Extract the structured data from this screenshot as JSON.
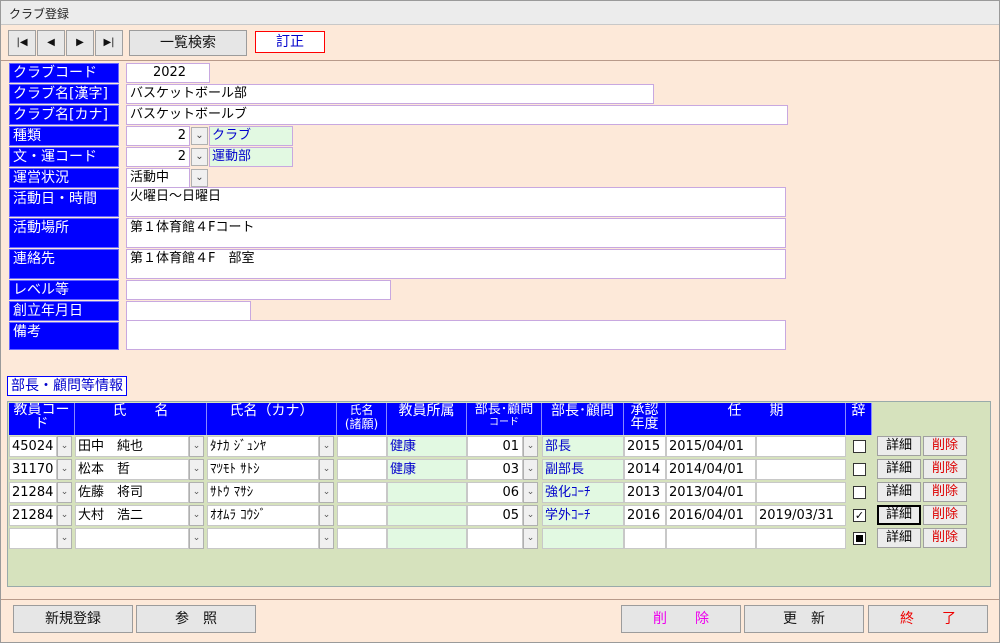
{
  "window": {
    "title": "クラブ登録"
  },
  "toolbar": {
    "first": "|◀",
    "prev": "◀",
    "next": "▶",
    "last": "▶|",
    "search_label": "一覧検索",
    "correct_label": "訂正"
  },
  "form": {
    "club_code": {
      "label": "クラブコード",
      "value": "2022"
    },
    "club_name_kanji": {
      "label": "クラブ名[漢字]",
      "value": "バスケットボール部"
    },
    "club_name_kana": {
      "label": "クラブ名[カナ]",
      "value": "バスケットボールブ"
    },
    "kind": {
      "label": "種類",
      "code": "2",
      "name": "クラブ"
    },
    "bun_un_code": {
      "label": "文・運コード",
      "code": "2",
      "name": "運動部"
    },
    "status": {
      "label": "運営状況",
      "value": "活動中"
    },
    "activity_time": {
      "label": "活動日・時間",
      "value": "火曜日～日曜日"
    },
    "activity_place": {
      "label": "活動場所",
      "value": "第１体育館４Fコート"
    },
    "contact": {
      "label": "連絡先",
      "value": "第１体育館４F　部室"
    },
    "level": {
      "label": "レベル等",
      "value": ""
    },
    "founded": {
      "label": "創立年月日",
      "value": ""
    },
    "remarks": {
      "label": "備考",
      "value": ""
    }
  },
  "section_title": "部長・顧問等情報",
  "grid": {
    "headers": {
      "teacher_code": "教員コード",
      "name": "氏　　名",
      "name_kana": "氏名（カナ）",
      "name_alias_1": "氏名",
      "name_alias_2": "(諸願)",
      "affiliation": "教員所属",
      "role_code_1": "部長･顧問",
      "role_code_2": "コード",
      "role": "部長･顧問",
      "year_1": "承認",
      "year_2": "年度",
      "term": "任　　期",
      "resign": "辞"
    },
    "rows": [
      {
        "code": "45024",
        "name": "田中　純也",
        "kana": "ﾀﾅｶ ｼﾞｭﾝﾔ",
        "affil": "健康",
        "role_code": "01",
        "role": "部長",
        "year": "2015",
        "from": "2015/04/01",
        "to": "",
        "resigned": false
      },
      {
        "code": "31170",
        "name": "松本　哲",
        "kana": "ﾏﾂﾓﾄ ｻﾄｼ",
        "affil": "健康",
        "role_code": "03",
        "role": "副部長",
        "year": "2014",
        "from": "2014/04/01",
        "to": "",
        "resigned": false
      },
      {
        "code": "21284",
        "name": "佐藤　将司",
        "kana": "ｻﾄｳ ﾏｻｼ",
        "affil": "",
        "role_code": "06",
        "role": "強化ｺｰﾁ",
        "year": "2013",
        "from": "2013/04/01",
        "to": "",
        "resigned": false
      },
      {
        "code": "21284",
        "name": "大村　浩二",
        "kana": "ｵｵﾑﾗ ｺｳｼﾞ",
        "affil": "",
        "role_code": "05",
        "role": "学外ｺｰﾁ",
        "year": "2016",
        "from": "2016/04/01",
        "to": "2019/03/31",
        "resigned": true
      },
      {
        "code": "",
        "name": "",
        "kana": "",
        "affil": "",
        "role_code": "",
        "role": "",
        "year": "",
        "from": "",
        "to": "",
        "resigned": null
      }
    ],
    "detail_label": "詳細",
    "delete_label": "削除"
  },
  "footer": {
    "new_label": "新規登録",
    "ref_label": "参　照",
    "delete_label": "削　　除",
    "update_label": "更　新",
    "exit_label": "終　　了"
  },
  "colors": {
    "label_bg": "#0000ff",
    "window_bg": "#fde9d9",
    "grid_bg": "#d6e2bd",
    "delete_text": "#dd0000"
  }
}
